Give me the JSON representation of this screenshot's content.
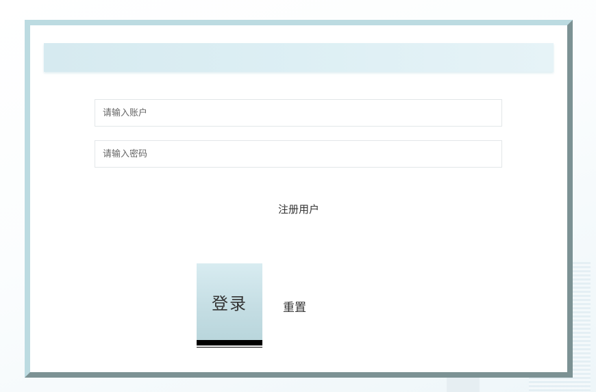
{
  "login_form": {
    "account_placeholder": "请输入账户",
    "password_placeholder": "请输入密码",
    "register_label": "注册用户",
    "login_label": "登录",
    "reset_label": "重置"
  },
  "colors": {
    "frame_light": "#bcdbe1",
    "frame_dark": "#7c9294",
    "header_band": "#d6eaf0",
    "login_button": "#c4dde3"
  }
}
